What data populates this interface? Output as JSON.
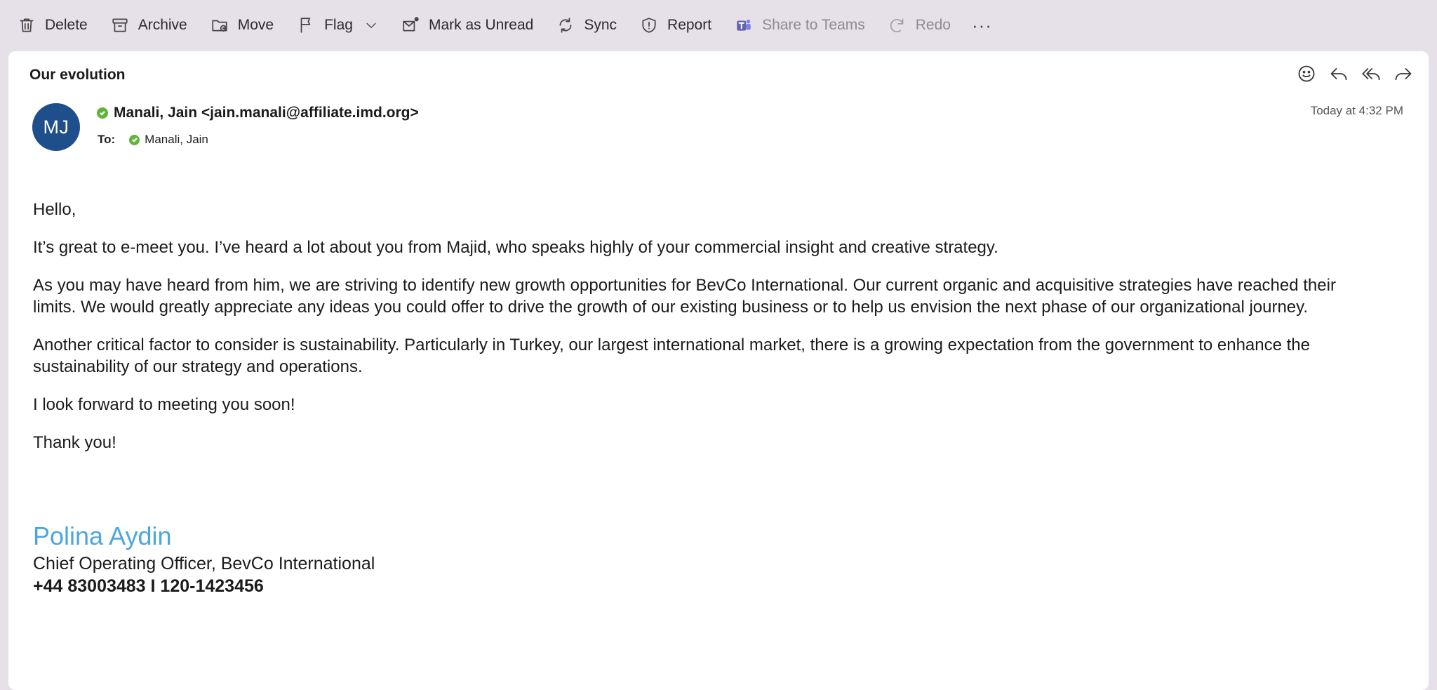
{
  "toolbar": {
    "delete": "Delete",
    "archive": "Archive",
    "move": "Move",
    "flag": "Flag",
    "mark_unread": "Mark as Unread",
    "sync": "Sync",
    "report": "Report",
    "share_teams": "Share to Teams",
    "redo": "Redo",
    "more": "···"
  },
  "message": {
    "subject": "Our evolution",
    "avatar_initials": "MJ",
    "from": "Manali, Jain <jain.manali@affiliate.imd.org>",
    "to_label": "To:",
    "to": "Manali, Jain",
    "timestamp": "Today at 4:32 PM",
    "body": [
      "Hello,",
      "It’s great to e-meet you. I’ve heard a lot about you from Majid, who speaks highly of your commercial insight and creative strategy.",
      "As you may have heard from him, we are striving to identify new growth opportunities for BevCo International. Our current organic and acquisitive strategies have reached their limits. We would greatly appreciate any ideas you could offer to drive the growth of our existing business or to help us envision the next phase of our organizational journey.",
      "Another critical factor to consider is sustainability. Particularly in Turkey, our largest international market, there is a growing expectation from the government to enhance the sustainability of our strategy and operations.",
      "I look forward to meeting you soon!",
      "Thank you!"
    ],
    "signature": {
      "name": "Polina Aydin",
      "title": "Chief Operating Officer, BevCo International",
      "phone": "+44 83003483 I 120-1423456"
    }
  },
  "colors": {
    "avatar_bg": "#1f4e8c",
    "presence": "#5fb537",
    "signature_name": "#4aa6e0",
    "chrome_bg": "#e6e1e9"
  }
}
